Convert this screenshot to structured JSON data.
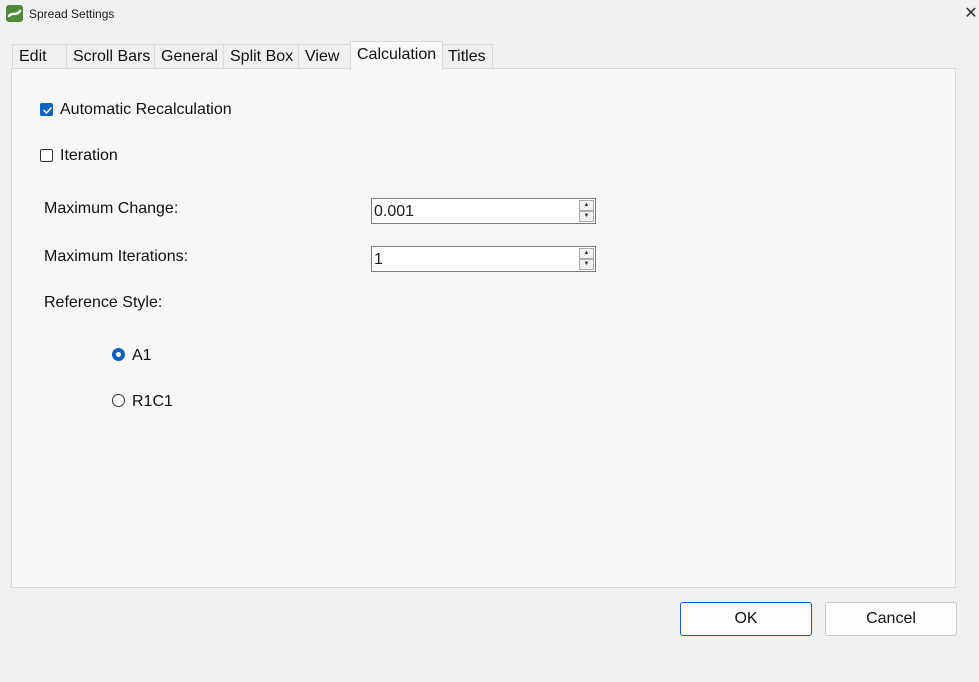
{
  "window": {
    "title": "Spread Settings",
    "close_glyph": "✕"
  },
  "tabs": [
    {
      "label": "Edit",
      "active": false
    },
    {
      "label": "Scroll Bars",
      "active": false
    },
    {
      "label": "General",
      "active": false
    },
    {
      "label": "Split Box",
      "active": false
    },
    {
      "label": "View",
      "active": false
    },
    {
      "label": "Calculation",
      "active": true
    },
    {
      "label": "Titles",
      "active": false
    }
  ],
  "calculation": {
    "auto_recalc": {
      "label": "Automatic Recalculation",
      "checked": true
    },
    "iteration": {
      "label": "Iteration",
      "checked": false
    },
    "max_change": {
      "label": "Maximum Change:",
      "value": "0.001"
    },
    "max_iterations": {
      "label": "Maximum Iterations:",
      "value": "1"
    },
    "reference_style": {
      "label": "Reference Style:",
      "options": [
        {
          "label": "A1",
          "selected": true
        },
        {
          "label": "R1C1",
          "selected": false
        }
      ]
    }
  },
  "buttons": {
    "ok": "OK",
    "cancel": "Cancel"
  },
  "colors": {
    "accent": "#0f62be",
    "background": "#f0f0f0",
    "panel": "#f7f7f7"
  },
  "icons": {
    "app": "spread-logo-icon",
    "close": "close-icon",
    "check": "checkmark-icon",
    "spin_up": "spin-up-arrow-icon",
    "spin_down": "spin-down-arrow-icon"
  }
}
